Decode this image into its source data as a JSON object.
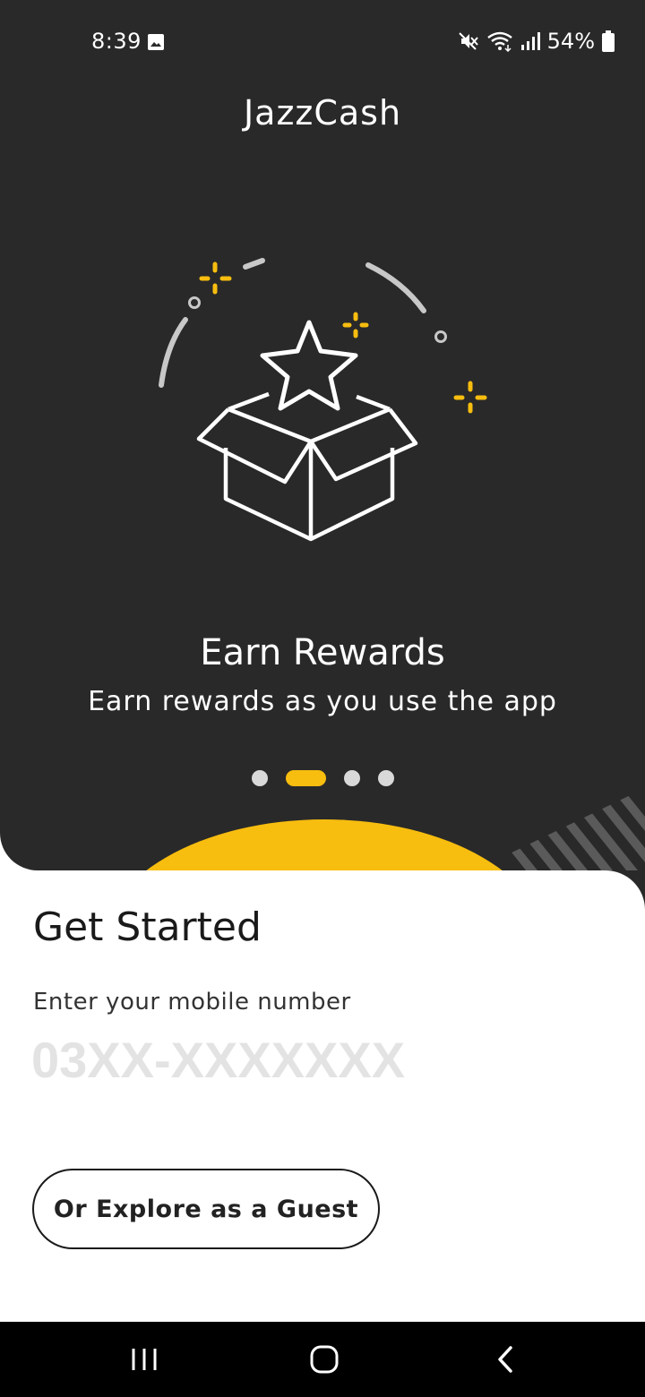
{
  "status_bar": {
    "time": "8:39",
    "battery": "54%",
    "icons": [
      "image-icon",
      "mute-icon",
      "wifi-icon",
      "signal-icon",
      "battery-icon"
    ]
  },
  "header": {
    "title": "JazzCash"
  },
  "carousel": {
    "title": "Earn Rewards",
    "subtitle": "Earn rewards as you use the app",
    "slide_count": 4,
    "active_index": 1,
    "illustration_icon": "gift-box-star-icon"
  },
  "get_started": {
    "heading": "Get Started",
    "mobile_label": "Enter your mobile number",
    "mobile_placeholder": "03XX-XXXXXXX",
    "guest_button": "Or Explore as a Guest"
  },
  "nav": {
    "icons": [
      "recent-apps-icon",
      "home-icon",
      "back-icon"
    ]
  },
  "colors": {
    "background": "#292929",
    "accent": "#F7BD0F",
    "sheet": "#FFFFFF"
  }
}
